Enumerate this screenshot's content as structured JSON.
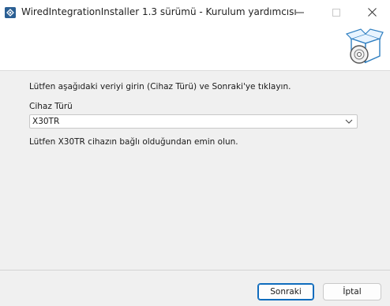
{
  "window": {
    "title": "WiredIntegrationInstaller 1.3 sürümü - Kurulum yardımcısı"
  },
  "content": {
    "instruction": "Lütfen aşağıdaki veriyi girin (Cihaz Türü) ve Sonraki'ye tıklayın.",
    "device_type_label": "Cihaz Türü",
    "device_type_value": "X30TR",
    "hint": "Lütfen X30TR cihazın bağlı olduğundan emin olun."
  },
  "buttons": {
    "next": "Sonraki",
    "cancel": "İptal"
  },
  "colors": {
    "accent": "#0f6cbd",
    "titlebar_bg": "#ffffff",
    "body_bg": "#f0f0f0"
  }
}
